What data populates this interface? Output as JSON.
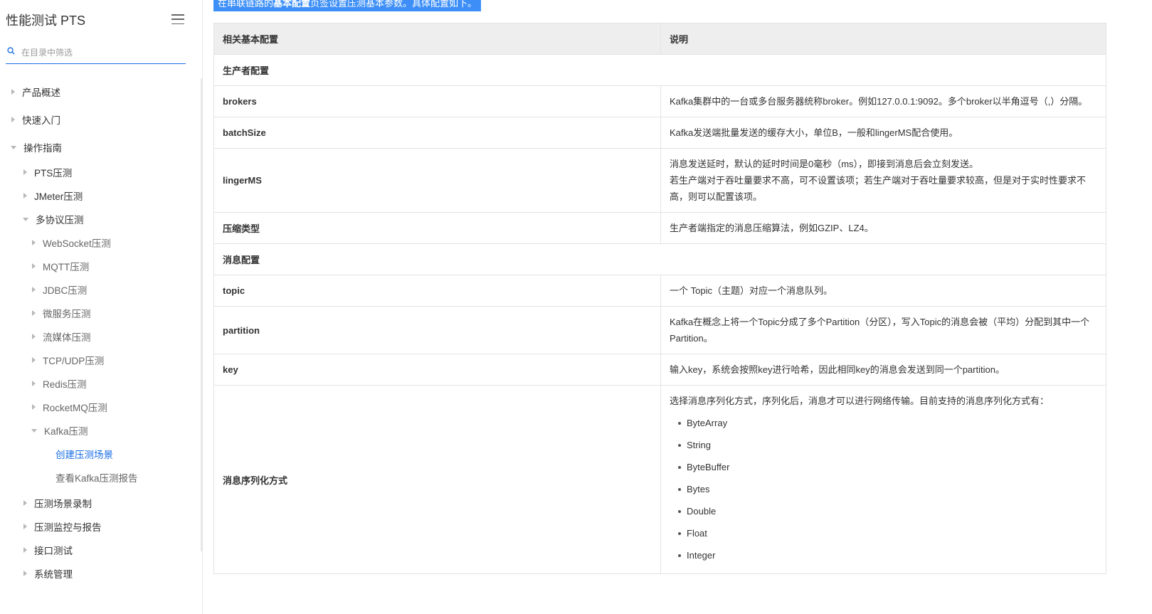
{
  "sidebar": {
    "title": "性能测试 PTS",
    "search_placeholder": "在目录中筛选",
    "items": [
      {
        "label": "产品概述"
      },
      {
        "label": "快速入门"
      },
      {
        "label": "操作指南"
      },
      {
        "label": "PTS压测"
      },
      {
        "label": "JMeter压测"
      },
      {
        "label": "多协议压测"
      },
      {
        "label": "WebSocket压测"
      },
      {
        "label": "MQTT压测"
      },
      {
        "label": "JDBC压测"
      },
      {
        "label": "微服务压测"
      },
      {
        "label": "流媒体压测"
      },
      {
        "label": "TCP/UDP压测"
      },
      {
        "label": "Redis压测"
      },
      {
        "label": "RocketMQ压测"
      },
      {
        "label": "Kafka压测"
      },
      {
        "label": "创建压测场景"
      },
      {
        "label": "查看Kafka压测报告"
      },
      {
        "label": "压测场景录制"
      },
      {
        "label": "压测监控与报告"
      },
      {
        "label": "接口测试"
      },
      {
        "label": "系统管理"
      }
    ]
  },
  "content": {
    "intro_before": "在串联链路的",
    "intro_bold": "基本配置",
    "intro_after": "页签设置压测基本参数。具体配置如下。",
    "table": {
      "header_name": "相关基本配置",
      "header_desc": "说明",
      "group_producer": "生产者配置",
      "group_message": "消息配置",
      "rows": [
        {
          "name": "brokers",
          "desc": "Kafka集群中的一台或多台服务器统称broker。例如127.0.0.1:9092。多个broker以半角逗号（,）分隔。"
        },
        {
          "name": "batchSize",
          "desc": "Kafka发送端批量发送的缓存大小，单位B，一般和lingerMS配合使用。"
        },
        {
          "name": "lingerMS",
          "desc_line1": "消息发送延时，默认的延时时间是0毫秒（ms），即接到消息后会立刻发送。",
          "desc_line2": "若生产端对于吞吐量要求不高，可不设置该项；若生产端对于吞吐量要求较高，但是对于实时性要求不高，则可以配置该项。"
        },
        {
          "name": "压缩类型",
          "desc": "生产者端指定的消息压缩算法，例如GZIP、LZ4。"
        },
        {
          "name": "topic",
          "desc": "一个 Topic（主题）对应一个消息队列。"
        },
        {
          "name": "partition",
          "desc": "Kafka在概念上将一个Topic分成了多个Partition（分区），写入Topic的消息会被（平均）分配到其中一个Partition。"
        },
        {
          "name": "key",
          "desc": "输入key，系统会按照key进行哈希，因此相同key的消息会发送到同一个partition。"
        },
        {
          "name": "消息序列化方式",
          "desc": "选择消息序列化方式，序列化后，消息才可以进行网络传输。目前支持的消息序列化方式有：",
          "options": [
            "ByteArray",
            "String",
            "ByteBuffer",
            "Bytes",
            "Double",
            "Float",
            "Integer"
          ]
        }
      ]
    }
  },
  "colors": {
    "accent": "#1a6ee4",
    "highlight": "#3d8ff7",
    "header_bg": "#eeeeee"
  }
}
